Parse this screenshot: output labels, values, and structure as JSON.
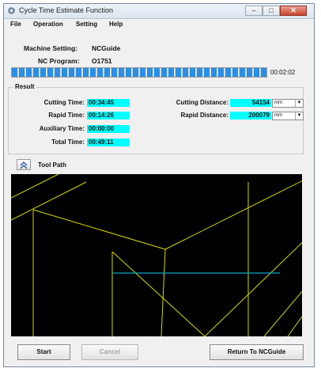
{
  "window": {
    "title": "Cycle Time Estimate Function",
    "icon": "gear-app-icon"
  },
  "title_buttons": {
    "minimize": "–",
    "maximize": "□",
    "close": "✕"
  },
  "menu": [
    "File",
    "Operation",
    "Setting",
    "Help"
  ],
  "header": {
    "machine_setting_label": "Machine Setting:",
    "machine_setting_value": "NCGuide",
    "nc_program_label": "NC Program:",
    "nc_program_value": "O1751"
  },
  "progress": {
    "fraction": 1.0,
    "elapsed": "00:02:02"
  },
  "result": {
    "legend": "Result",
    "cutting_time_label": "Cutting Time:",
    "cutting_time": "00:34:45",
    "rapid_time_label": "Rapid Time:",
    "rapid_time": "00:14:26",
    "auxiliary_time_label": "Auxiliary Time:",
    "auxiliary_time": "00:00:00",
    "total_time_label": "Total Time:",
    "total_time": "00:49:11",
    "cutting_distance_label": "Cutting Distance:",
    "cutting_distance": "54154",
    "cutting_distance_unit": "mm",
    "rapid_distance_label": "Rapid Distance:",
    "rapid_distance": "200079",
    "rapid_distance_unit": "mm"
  },
  "tool_path": {
    "label": "Tool Path",
    "toggle_icon": "collapse-arrow-icon"
  },
  "canvas_colors": {
    "background": "#000000",
    "path": "#d8d800",
    "highlight": "#00a6c8"
  },
  "buttons": {
    "start": "Start",
    "cancel": "Cancel",
    "return": "Return To NCGuide"
  }
}
